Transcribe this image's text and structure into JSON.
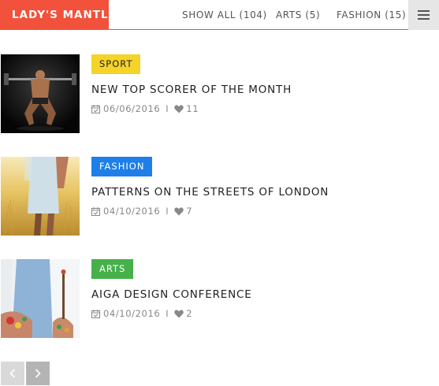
{
  "header": {
    "brand": "LADY'S MANTLE",
    "nav": [
      {
        "label": "SHOW ALL (104)"
      },
      {
        "label": "ARTS (5)"
      },
      {
        "label": "FASHION (15)"
      }
    ],
    "menu_icon": "hamburger-menu-icon"
  },
  "posts": [
    {
      "category": "SPORT",
      "category_color": "#f5d328",
      "category_text_color": "#222222",
      "title": "NEW TOP SCORER OF THE MONTH",
      "date": "06/06/2016",
      "likes": "11",
      "separator": "I"
    },
    {
      "category": "FASHION",
      "category_color": "#1e7fe8",
      "category_text_color": "#ffffff",
      "title": "PATTERNS ON THE STREETS OF LONDON",
      "date": "04/10/2016",
      "likes": "7",
      "separator": "I"
    },
    {
      "category": "ARTS",
      "category_color": "#46b04a",
      "category_text_color": "#ffffff",
      "title": "AIGA DESIGN CONFERENCE",
      "date": "04/10/2016",
      "likes": "2",
      "separator": "I"
    }
  ],
  "pagination": {
    "prev_icon": "chevron-left-icon",
    "next_icon": "chevron-right-icon"
  },
  "colors": {
    "brand": "#f2513b",
    "meta_text": "#888888",
    "title_text": "#222222"
  }
}
